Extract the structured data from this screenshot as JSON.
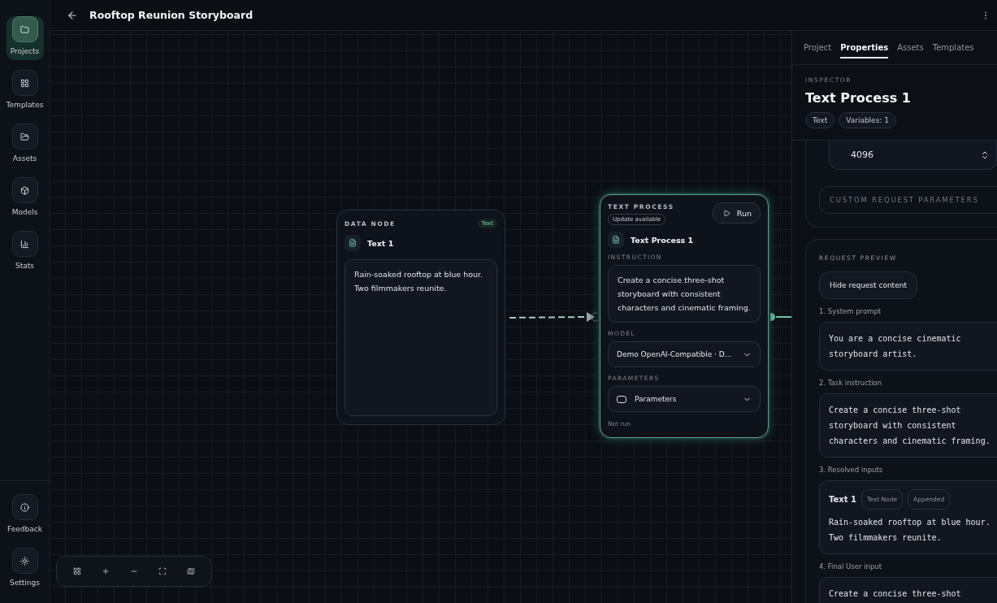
{
  "sidebar": {
    "items": [
      {
        "label": "Projects",
        "selected": true
      },
      {
        "label": "Templates",
        "selected": false
      },
      {
        "label": "Assets",
        "selected": false
      },
      {
        "label": "Models",
        "selected": false
      },
      {
        "label": "Stats",
        "selected": false
      }
    ],
    "bottom_items": [
      {
        "label": "Feedback"
      },
      {
        "label": "Settings"
      }
    ]
  },
  "header": {
    "title": "Rooftop Reunion Storyboard"
  },
  "canvas": {
    "data_node": {
      "label": "DATA NODE",
      "badge": "Text",
      "title": "Text 1",
      "content": "Rain-soaked rooftop at blue hour. Two filmmakers reunite."
    },
    "process_node": {
      "label": "TEXT PROCESS",
      "update_badge": "Update available",
      "run_button": "Run",
      "title": "Text Process 1",
      "instruction_label": "INSTRUCTION",
      "instruction": "Create a concise three-shot storyboard with consistent characters and cinematic framing.",
      "model_label": "MODEL",
      "model": "Demo OpenAI-Compatible · D...",
      "parameters_label": "PARAMETERS",
      "parameters": "Parameters",
      "status": "Not run",
      "selected": true
    }
  },
  "panel": {
    "tabs": [
      {
        "label": "Project",
        "selected": false
      },
      {
        "label": "Properties",
        "selected": true
      },
      {
        "label": "Assets",
        "selected": false
      },
      {
        "label": "Templates",
        "selected": false
      }
    ],
    "inspector_label": "INSPECTOR",
    "title": "Text Process 1",
    "chips": [
      "Text",
      "Variables: 1"
    ],
    "max_tokens": "4096",
    "custom_params": "CUSTOM REQUEST PARAMETERS",
    "request_preview": {
      "heading": "REQUEST PREVIEW",
      "button": "Hide request content",
      "sections": [
        {
          "kind": "text",
          "label": "1. System prompt",
          "content": "You are a concise cinematic storyboard artist."
        },
        {
          "kind": "text",
          "label": "2. Task instruction",
          "content": "Create a concise three-shot storyboard with consistent characters and cinematic framing."
        },
        {
          "kind": "input",
          "label": "3. Resolved inputs",
          "name": "Text 1",
          "tags": [
            "Text Node",
            "Appended"
          ],
          "content": "Rain-soaked rooftop at blue hour. Two filmmakers reunite."
        },
        {
          "kind": "text",
          "label": "4. Final User input",
          "content": "Create a concise three-shot"
        }
      ]
    }
  }
}
